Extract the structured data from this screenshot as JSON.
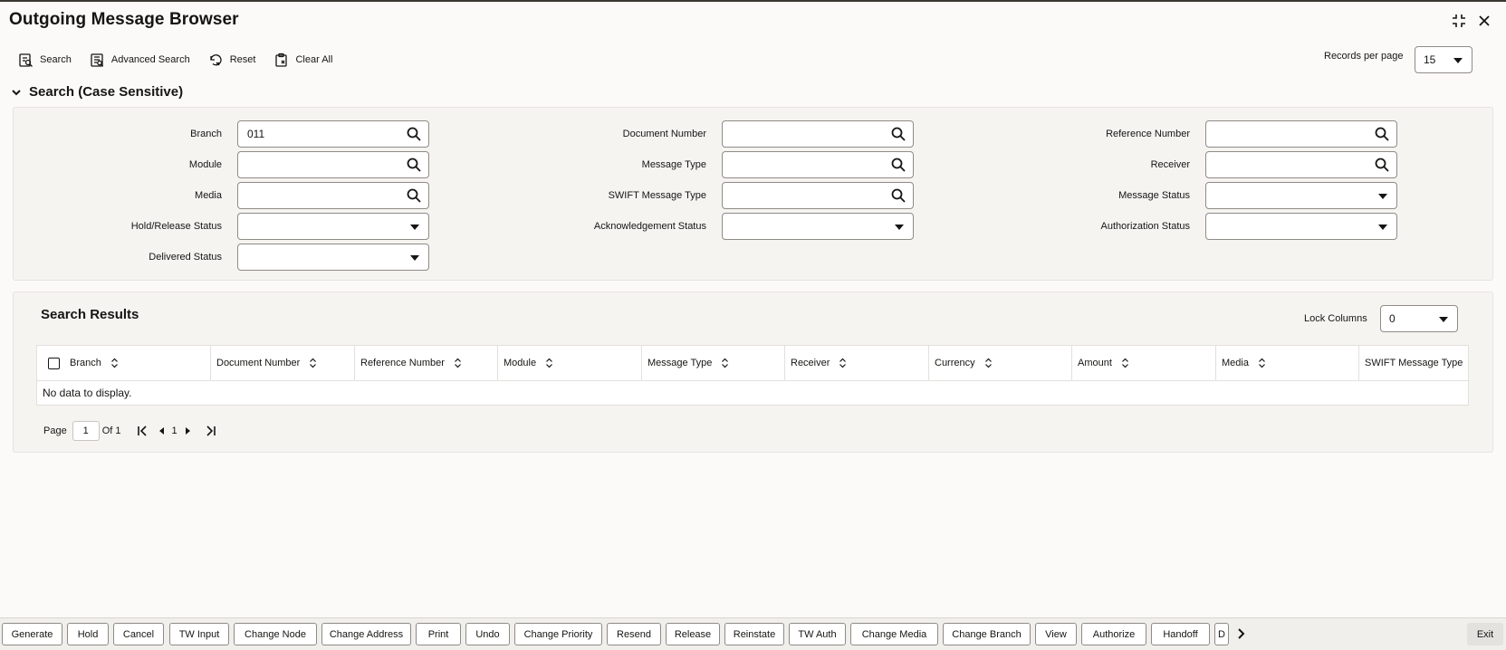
{
  "window": {
    "title": "Outgoing Message Browser",
    "maximize_icon": "maximize-icon",
    "close_icon": "close-icon"
  },
  "toolbar": {
    "search": "Search",
    "advanced_search": "Advanced Search",
    "reset": "Reset",
    "clear_all": "Clear All"
  },
  "records_per_page": {
    "label": "Records per page",
    "value": "15"
  },
  "search_section": {
    "title": "Search (Case Sensitive)",
    "fields": {
      "branch": {
        "label": "Branch",
        "value": "011"
      },
      "document_number": {
        "label": "Document Number",
        "value": ""
      },
      "reference_number": {
        "label": "Reference Number",
        "value": ""
      },
      "module": {
        "label": "Module",
        "value": ""
      },
      "message_type": {
        "label": "Message Type",
        "value": ""
      },
      "receiver": {
        "label": "Receiver",
        "value": ""
      },
      "media": {
        "label": "Media",
        "value": ""
      },
      "swift_message_type": {
        "label": "SWIFT Message Type",
        "value": ""
      },
      "message_status": {
        "label": "Message Status",
        "value": ""
      },
      "hold_release_status": {
        "label": "Hold/Release Status",
        "value": ""
      },
      "acknowledgement_status": {
        "label": "Acknowledgement Status",
        "value": ""
      },
      "authorization_status": {
        "label": "Authorization Status",
        "value": ""
      },
      "delivered_status": {
        "label": "Delivered Status",
        "value": ""
      }
    }
  },
  "results": {
    "title": "Search Results",
    "lock_columns": {
      "label": "Lock Columns",
      "value": "0"
    },
    "columns": [
      "Branch",
      "Document Number",
      "Reference Number",
      "Module",
      "Message Type",
      "Receiver",
      "Currency",
      "Amount",
      "Media",
      "SWIFT Message Type"
    ],
    "empty_text": "No data to display.",
    "pager": {
      "page_label": "Page",
      "page_value": "1",
      "of_label": "Of 1",
      "current": "1"
    }
  },
  "actions": [
    "Generate",
    "Hold",
    "Cancel",
    "TW Input",
    "Change Node",
    "Change Address",
    "Print",
    "Undo",
    "Change Priority",
    "Resend",
    "Release",
    "Reinstate",
    "TW Auth",
    "Change Media",
    "Change Branch",
    "View",
    "Authorize",
    "Handoff",
    "D"
  ],
  "exit": "Exit"
}
